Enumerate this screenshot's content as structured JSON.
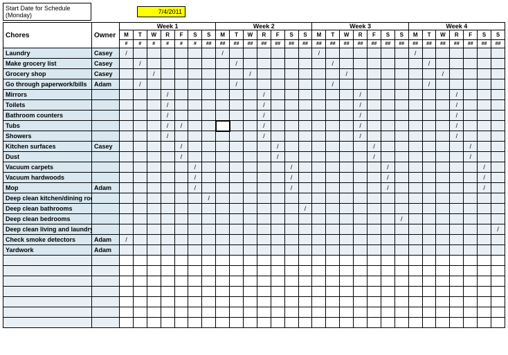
{
  "header": {
    "start_label": "Start Date for Schedule (Monday)",
    "date": "7/4/2011",
    "chores_label": "Chores",
    "owner_label": "Owner"
  },
  "weeks": [
    "Week 1",
    "Week 2",
    "Week 3",
    "Week 4"
  ],
  "days": [
    "M",
    "T",
    "W",
    "R",
    "F",
    "S",
    "S"
  ],
  "subs": [
    "#",
    "#",
    "#",
    "#",
    "#",
    "#",
    "##"
  ],
  "subs_wk_other": [
    "##",
    "##",
    "##",
    "##",
    "##",
    "##",
    "##"
  ],
  "chores": [
    {
      "name": "Laundry",
      "owner": "Casey",
      "marks": [
        [
          0
        ],
        [
          0
        ],
        [
          0
        ],
        [
          0
        ]
      ]
    },
    {
      "name": "Make grocery list",
      "owner": "Casey",
      "marks": [
        [
          1
        ],
        [
          1
        ],
        [
          1
        ],
        [
          1
        ]
      ]
    },
    {
      "name": "Grocery shop",
      "owner": "Casey",
      "marks": [
        [
          2
        ],
        [
          2
        ],
        [
          2
        ],
        [
          2
        ]
      ]
    },
    {
      "name": "Go through paperwork/bills",
      "owner": "Adam",
      "marks": [
        [
          1
        ],
        [
          1
        ],
        [
          1
        ],
        [
          1
        ]
      ]
    },
    {
      "name": "Mirrors",
      "owner": "",
      "marks": [
        [
          3
        ],
        [
          3
        ],
        [
          3
        ],
        [
          3
        ]
      ]
    },
    {
      "name": "Toilets",
      "owner": "",
      "marks": [
        [
          3
        ],
        [
          3
        ],
        [
          3
        ],
        [
          3
        ]
      ]
    },
    {
      "name": "Bathroom counters",
      "owner": "",
      "marks": [
        [
          3
        ],
        [
          3
        ],
        [
          3
        ],
        [
          3
        ]
      ]
    },
    {
      "name": "Tubs",
      "owner": "",
      "marks": [
        [
          3,
          4
        ],
        [
          3
        ],
        [
          3
        ],
        [
          3
        ]
      ]
    },
    {
      "name": "Showers",
      "owner": "",
      "marks": [
        [
          3
        ],
        [
          3
        ],
        [
          3
        ],
        [
          3
        ]
      ]
    },
    {
      "name": "Kitchen surfaces",
      "owner": "Casey",
      "marks": [
        [
          4
        ],
        [
          4
        ],
        [
          4
        ],
        [
          4
        ]
      ]
    },
    {
      "name": "Dust",
      "owner": "",
      "marks": [
        [
          4
        ],
        [
          4
        ],
        [
          4
        ],
        [
          4
        ]
      ]
    },
    {
      "name": "Vacuum carpets",
      "owner": "",
      "marks": [
        [
          5
        ],
        [
          5
        ],
        [
          5
        ],
        [
          5
        ]
      ]
    },
    {
      "name": "Vacuum hardwoods",
      "owner": "",
      "marks": [
        [
          5
        ],
        [
          5
        ],
        [
          5
        ],
        [
          5
        ]
      ]
    },
    {
      "name": "Mop",
      "owner": "Adam",
      "marks": [
        [
          5
        ],
        [
          5
        ],
        [
          5
        ],
        [
          5
        ]
      ]
    },
    {
      "name": "Deep clean kitchen/dining room",
      "owner": "",
      "marks": [
        [
          6
        ],
        [],
        [],
        []
      ]
    },
    {
      "name": "Deep clean bathrooms",
      "owner": "",
      "marks": [
        [],
        [
          6
        ],
        [],
        []
      ]
    },
    {
      "name": "Deep clean bedrooms",
      "owner": "",
      "marks": [
        [],
        [],
        [
          6
        ],
        []
      ]
    },
    {
      "name": "Deep clean living and laundry rooms",
      "owner": "",
      "marks": [
        [],
        [],
        [],
        [
          6
        ]
      ]
    },
    {
      "name": "Check smoke detectors",
      "owner": "Adam",
      "marks": [
        [
          0
        ],
        [],
        [],
        []
      ]
    },
    {
      "name": "Yardwork",
      "owner": "Adam",
      "marks": [
        [],
        [],
        [],
        []
      ]
    }
  ],
  "mark_char": "/",
  "blank_rows": 7,
  "selected": {
    "row": 7,
    "week": 1,
    "day": 0
  }
}
